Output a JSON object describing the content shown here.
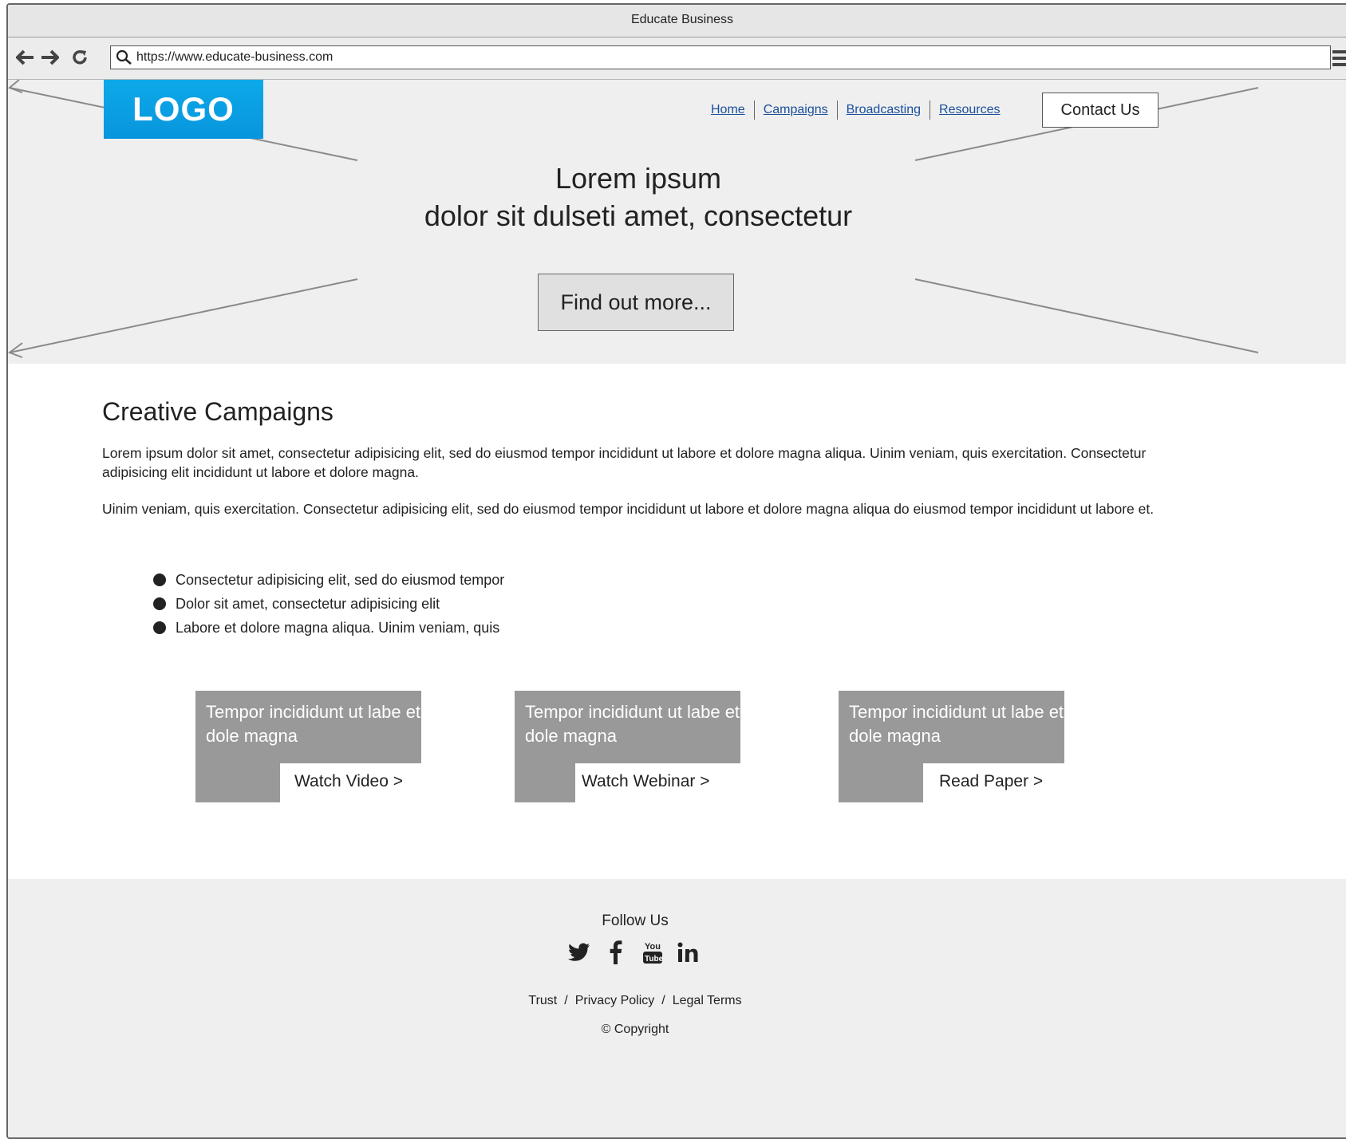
{
  "window": {
    "title": "Educate Business"
  },
  "browser": {
    "url": "https://www.educate-business.com"
  },
  "header": {
    "logo_text": "LOGO",
    "nav": [
      "Home",
      "Campaigns",
      "Broadcasting",
      "Resources"
    ],
    "contact_label": "Contact Us"
  },
  "hero": {
    "title_line1": "Lorem ipsum",
    "title_line2": "dolor sit dulseti amet, consectetur",
    "cta_label": "Find out more..."
  },
  "main": {
    "heading": "Creative Campaigns",
    "paragraph1": "Lorem ipsum dolor sit amet, consectetur adipisicing elit, sed do eiusmod tempor incididunt ut labore et dolore magna aliqua. Uinim veniam, quis exercitation. Consectetur adipisicing elit incididunt ut labore et dolore magna.",
    "paragraph2": "Uinim veniam, quis exercitation. Consectetur adipisicing elit, sed do eiusmod tempor incididunt ut labore et dolore magna aliqua do eiusmod tempor incididunt ut labore et.",
    "bullets": [
      "Consectetur adipisicing elit, sed do eiusmod tempor",
      "Dolor sit amet, consectetur adipisicing elit",
      "Labore et dolore magna aliqua. Uinim veniam, quis"
    ],
    "cards": [
      {
        "title": "Tempor incididunt ut labe et dole magna",
        "link": "Watch Video >"
      },
      {
        "title": "Tempor incididunt ut labe et dole magna",
        "link": "Watch Webinar >"
      },
      {
        "title": "Tempor incididunt ut labe et dole magna",
        "link": "Read Paper >"
      }
    ]
  },
  "footer": {
    "follow_label": "Follow Us",
    "social_icons": [
      "twitter-icon",
      "facebook-icon",
      "youtube-icon",
      "linkedin-icon"
    ],
    "links": [
      "Trust",
      "Privacy Policy",
      "Legal Terms"
    ],
    "copyright": "© Copyright"
  },
  "colors": {
    "logo": "#0da9e8",
    "link": "#1a4f9c",
    "card": "#999999",
    "hero_bg": "#efefef"
  }
}
